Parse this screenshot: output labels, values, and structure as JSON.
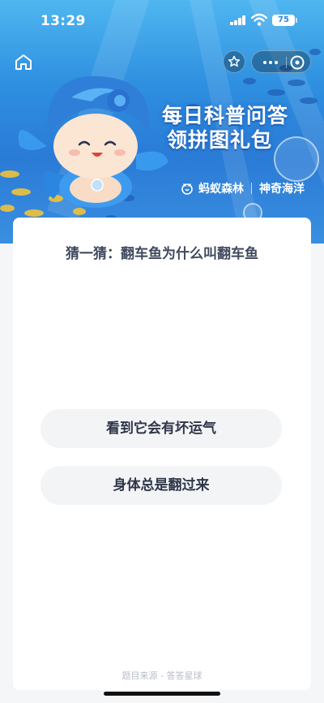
{
  "status_bar": {
    "time": "13:29",
    "battery": "75"
  },
  "banner": {
    "headline_line1": "每日科普问答",
    "headline_line2": "领拼图礼包",
    "brand_name": "蚂蚁森林",
    "brand_sub": "神奇海洋"
  },
  "quiz": {
    "question": "猜一猜：翻车鱼为什么叫翻车鱼",
    "options": [
      {
        "label": "看到它会有坏运气"
      },
      {
        "label": "身体总是翻过来"
      }
    ],
    "source": "题目来源 - 答答星球"
  },
  "colors": {
    "banner_blue": "#2e8fe0",
    "option_bg": "#f3f4f6",
    "question_text": "#404a5e"
  }
}
